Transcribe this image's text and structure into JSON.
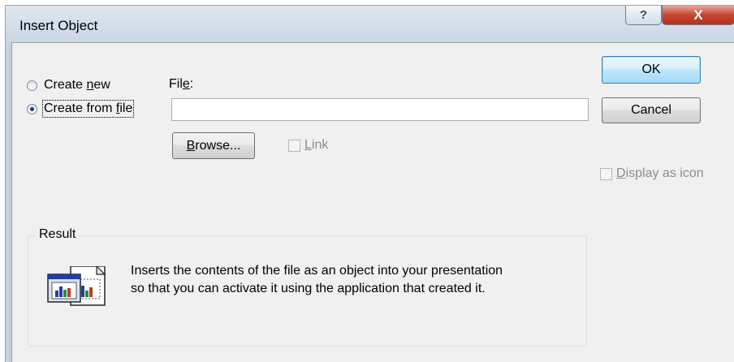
{
  "window": {
    "title": "Insert Object",
    "help_glyph": "?",
    "close_glyph": "X"
  },
  "options": {
    "create_new": {
      "label_before": "Create ",
      "label_accel": "n",
      "label_after": "ew",
      "checked": false
    },
    "create_from_file": {
      "label_before": "Create from ",
      "label_accel": "f",
      "label_after": "ile",
      "checked": true
    }
  },
  "file": {
    "label_before": "Fil",
    "label_accel": "e",
    "label_after": ":",
    "value": ""
  },
  "buttons": {
    "ok": "OK",
    "cancel": "Cancel",
    "browse_accel": "B",
    "browse_rest": "rowse..."
  },
  "link": {
    "label_accel": "L",
    "label_rest": "ink",
    "checked": false,
    "enabled": false
  },
  "display_as_icon": {
    "label_accel": "D",
    "label_rest": "isplay as icon",
    "checked": false,
    "enabled": false
  },
  "result": {
    "legend": "Result",
    "line1": "Inserts the contents of the file as an object into your presentation",
    "line2": "so that you can activate it using the application that created it.",
    "icon": "embedded-object-icon"
  },
  "colors": {
    "client_bg": "#f0f0f0",
    "ok_border": "#3c7fb1",
    "close_red": "#c6452e",
    "disabled_text": "#8c8c8c"
  }
}
